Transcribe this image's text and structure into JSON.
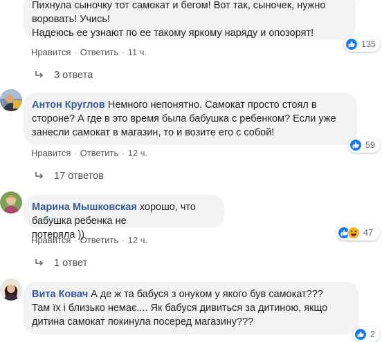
{
  "labels": {
    "like": "Нравится",
    "reply": "Ответить",
    "sep": "·"
  },
  "colors": {
    "like_blue": "#1877f2",
    "author_blue": "#385898",
    "bubble_bg": "#f2f3f5"
  },
  "comments": [
    {
      "author": "",
      "text": "Пихнула сыночку тот самокат и бегом! Вот так, сыночек, нужно\nворовать! Учись!\nНадеюсь ее узнают по ее такому яркому наряду и опозорят!",
      "time": "11 ч.",
      "reactions": "135",
      "replies": "3 ответа"
    },
    {
      "author": "Антон Круглов",
      "text": "Немного непонятно. Самокат просто стоял в\nстороне? А где в это время была бабушка с ребенком? Если уже\nзанесли самокат в магазин, то и возите его с собой!",
      "time": "12 ч.",
      "reactions": "59",
      "replies": "17 ответов"
    },
    {
      "author": "Марина Мышковская",
      "text": "хорошо, что бабушка ребенка не\nпотеряла ))",
      "time": "12 ч.",
      "reactions": "47",
      "replies": "1 ответ"
    },
    {
      "author": "Вита Ковач",
      "text": "А де ж та бабуся з онуком у якого був самокат???\nТам їх і близько немає.... Як бабуся дивиться за дитиною, якщо\nдитина самокат покинула посеред магазину???",
      "reactions": "2"
    }
  ]
}
